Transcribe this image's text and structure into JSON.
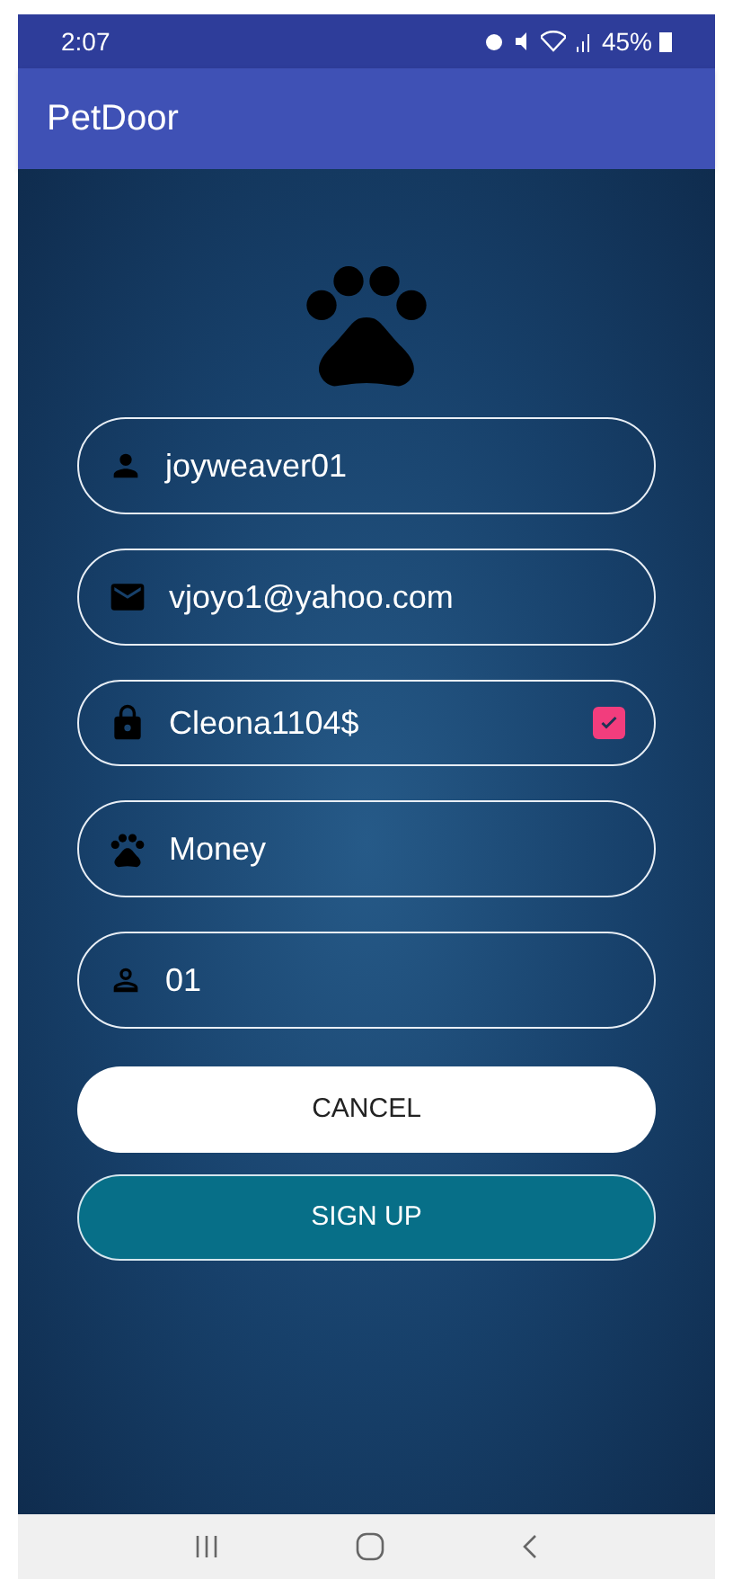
{
  "status_bar": {
    "time": "2:07",
    "battery": "45%"
  },
  "app_bar": {
    "title": "PetDoor"
  },
  "fields": [
    {
      "kind": "text",
      "value": "joyweaver01"
    },
    {
      "kind": "text",
      "value": "vjoyo1@yahoo.com"
    },
    {
      "kind": "toggle",
      "value": "Cleona1104$",
      "checked": true
    },
    {
      "kind": "text",
      "value": "Money"
    },
    {
      "kind": "text",
      "value": "01"
    }
  ],
  "buttons": [
    {
      "kind": "secondary",
      "label": "CANCEL"
    },
    {
      "kind": "primary",
      "label": "SIGN UP"
    }
  ]
}
